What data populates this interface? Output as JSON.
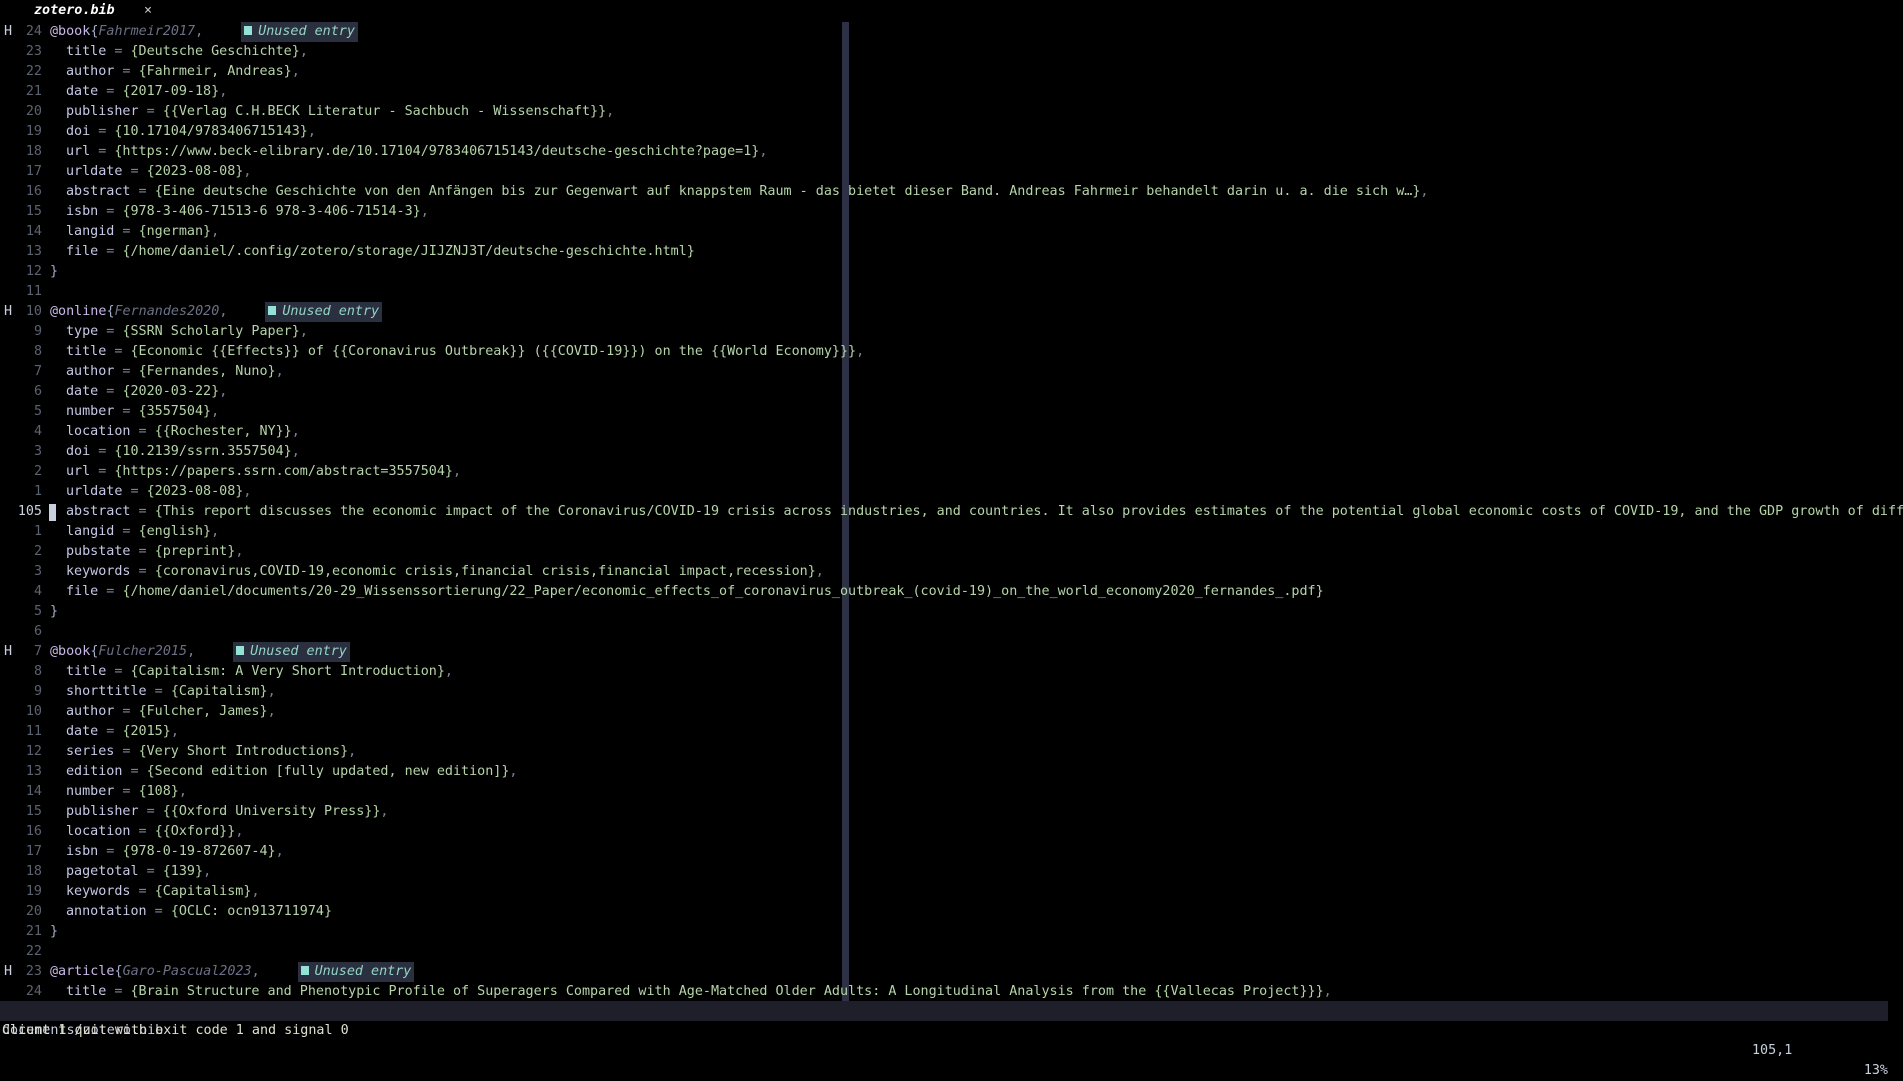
{
  "tabline": {
    "tab_label": "zotero.bib",
    "close_glyph": "×"
  },
  "diagnostic_text": "Unused entry",
  "lines": [
    {
      "sign": "H",
      "num": "24",
      "type": "entry",
      "kind": "@book",
      "key": "Fahrmeir2017",
      "diag": true
    },
    {
      "num": "23",
      "type": "field",
      "field": "title",
      "value": "{Deutsche Geschichte}",
      "tail": ","
    },
    {
      "num": "22",
      "type": "field",
      "field": "author",
      "value": "{Fahrmeir, Andreas}",
      "tail": ","
    },
    {
      "num": "21",
      "type": "field",
      "field": "date",
      "value": "{2017-09-18}",
      "tail": ","
    },
    {
      "num": "20",
      "type": "field",
      "field": "publisher",
      "value": "{{Verlag C.H.BECK Literatur - Sachbuch - Wissenschaft}}",
      "tail": ","
    },
    {
      "num": "19",
      "type": "field",
      "field": "doi",
      "value": "{10.17104/9783406715143}",
      "tail": ","
    },
    {
      "num": "18",
      "type": "field",
      "field": "url",
      "value": "{https://www.beck-elibrary.de/10.17104/9783406715143/deutsche-geschichte?page=1}",
      "tail": ","
    },
    {
      "num": "17",
      "type": "field",
      "field": "urldate",
      "value": "{2023-08-08}",
      "tail": ","
    },
    {
      "num": "16",
      "type": "field",
      "field": "abstract",
      "value": "{Eine deutsche Geschichte von den Anfängen bis zur Gegenwart auf knappstem Raum - das bietet dieser Band. Andreas Fahrmeir behandelt darin u. a. die sich w…}",
      "tail": ","
    },
    {
      "num": "15",
      "type": "field",
      "field": "isbn",
      "value": "{978-3-406-71513-6 978-3-406-71514-3}",
      "tail": ","
    },
    {
      "num": "14",
      "type": "field",
      "field": "langid",
      "value": "{ngerman}",
      "tail": ","
    },
    {
      "num": "13",
      "type": "field",
      "field": "file",
      "value": "{/home/daniel/.config/zotero/storage/JIJZNJ3T/deutsche-geschichte.html}",
      "tail": ""
    },
    {
      "num": "12",
      "type": "close",
      "text": "}"
    },
    {
      "num": "11",
      "type": "blank"
    },
    {
      "sign": "H",
      "num": "10",
      "type": "entry",
      "kind": "@online",
      "key": "Fernandes2020",
      "diag": true
    },
    {
      "num": "9",
      "type": "field",
      "field": "type",
      "value": "{SSRN Scholarly Paper}",
      "tail": ","
    },
    {
      "num": "8",
      "type": "field",
      "field": "title",
      "value": "{Economic {{Effects}} of {{Coronavirus Outbreak}} ({{COVID-19}}) on the {{World Economy}}}",
      "tail": ","
    },
    {
      "num": "7",
      "type": "field",
      "field": "author",
      "value": "{Fernandes, Nuno}",
      "tail": ","
    },
    {
      "num": "6",
      "type": "field",
      "field": "date",
      "value": "{2020-03-22}",
      "tail": ","
    },
    {
      "num": "5",
      "type": "field",
      "field": "number",
      "value": "{3557504}",
      "tail": ","
    },
    {
      "num": "4",
      "type": "field",
      "field": "location",
      "value": "{{Rochester, NY}}",
      "tail": ","
    },
    {
      "num": "3",
      "type": "field",
      "field": "doi",
      "value": "{10.2139/ssrn.3557504}",
      "tail": ","
    },
    {
      "num": "2",
      "type": "field",
      "field": "url",
      "value": "{https://papers.ssrn.com/abstract=3557504}",
      "tail": ","
    },
    {
      "num": "1",
      "type": "field",
      "field": "urldate",
      "value": "{2023-08-08}",
      "tail": ","
    },
    {
      "num": "105",
      "type": "field",
      "current": true,
      "field": "abstract",
      "value": "{This report discusses the economic impact of the Coronavirus/COVID-19 crisis across industries, and countries. It also provides estimates of the potential global economic costs of COVID-19, and the GDP growth of diffe",
      "tail": ""
    },
    {
      "num": "1",
      "type": "field",
      "field": "langid",
      "value": "{english}",
      "tail": ","
    },
    {
      "num": "2",
      "type": "field",
      "field": "pubstate",
      "value": "{preprint}",
      "tail": ","
    },
    {
      "num": "3",
      "type": "field",
      "field": "keywords",
      "value": "{coronavirus,COVID-19,economic crisis,financial crisis,financial impact,recession}",
      "tail": ","
    },
    {
      "num": "4",
      "type": "field",
      "field": "file",
      "value": "{/home/daniel/documents/20-29_Wissenssortierung/22_Paper/economic_effects_of_coronavirus_outbreak_(covid-19)_on_the_world_economy2020_fernandes_.pdf}",
      "tail": ""
    },
    {
      "num": "5",
      "type": "close",
      "text": "}"
    },
    {
      "num": "6",
      "type": "blank"
    },
    {
      "sign": "H",
      "num": "7",
      "type": "entry",
      "kind": "@book",
      "key": "Fulcher2015",
      "diag": true
    },
    {
      "num": "8",
      "type": "field",
      "field": "title",
      "value": "{Capitalism: A Very Short Introduction}",
      "tail": ","
    },
    {
      "num": "9",
      "type": "field",
      "field": "shorttitle",
      "value": "{Capitalism}",
      "tail": ","
    },
    {
      "num": "10",
      "type": "field",
      "field": "author",
      "value": "{Fulcher, James}",
      "tail": ","
    },
    {
      "num": "11",
      "type": "field",
      "field": "date",
      "value": "{2015}",
      "tail": ","
    },
    {
      "num": "12",
      "type": "field",
      "field": "series",
      "value": "{Very Short Introductions}",
      "tail": ","
    },
    {
      "num": "13",
      "type": "field",
      "field": "edition",
      "value": "{Second edition [fully updated, new edition]}",
      "tail": ","
    },
    {
      "num": "14",
      "type": "field",
      "field": "number",
      "value": "{108}",
      "tail": ","
    },
    {
      "num": "15",
      "type": "field",
      "field": "publisher",
      "value": "{{Oxford University Press}}",
      "tail": ","
    },
    {
      "num": "16",
      "type": "field",
      "field": "location",
      "value": "{{Oxford}}",
      "tail": ","
    },
    {
      "num": "17",
      "type": "field",
      "field": "isbn",
      "value": "{978-0-19-872607-4}",
      "tail": ","
    },
    {
      "num": "18",
      "type": "field",
      "field": "pagetotal",
      "value": "{139}",
      "tail": ","
    },
    {
      "num": "19",
      "type": "field",
      "field": "keywords",
      "value": "{Capitalism}",
      "tail": ","
    },
    {
      "num": "20",
      "type": "field",
      "field": "annotation",
      "value": "{OCLC: ocn913711974}",
      "tail": ""
    },
    {
      "num": "21",
      "type": "close",
      "text": "}"
    },
    {
      "num": "22",
      "type": "blank"
    },
    {
      "sign": "H",
      "num": "23",
      "type": "entry",
      "kind": "@article",
      "key": "Garo-Pascual2023",
      "diag": true
    },
    {
      "num": "24",
      "type": "field",
      "field": "title",
      "value": "{Brain Structure and Phenotypic Profile of Superagers Compared with Age-Matched Older Adults: A Longitudinal Analysis from the {{Vallecas Project}}}",
      "tail": ","
    }
  ],
  "statusline": {
    "file": "documents/zotero.bib",
    "position": "105,1",
    "percent": "13%"
  },
  "cmdline": "Client 1 quit with exit code 1 and signal 0",
  "colors": {
    "background": "#000000",
    "statusline_bg": "#1e1f2b",
    "colorcolumn": "#2e3046",
    "diag_bg": "#2b3040",
    "diag_fg": "#94d3c4",
    "value": "#b5d4a8",
    "keyword": "#c8b8e8"
  }
}
